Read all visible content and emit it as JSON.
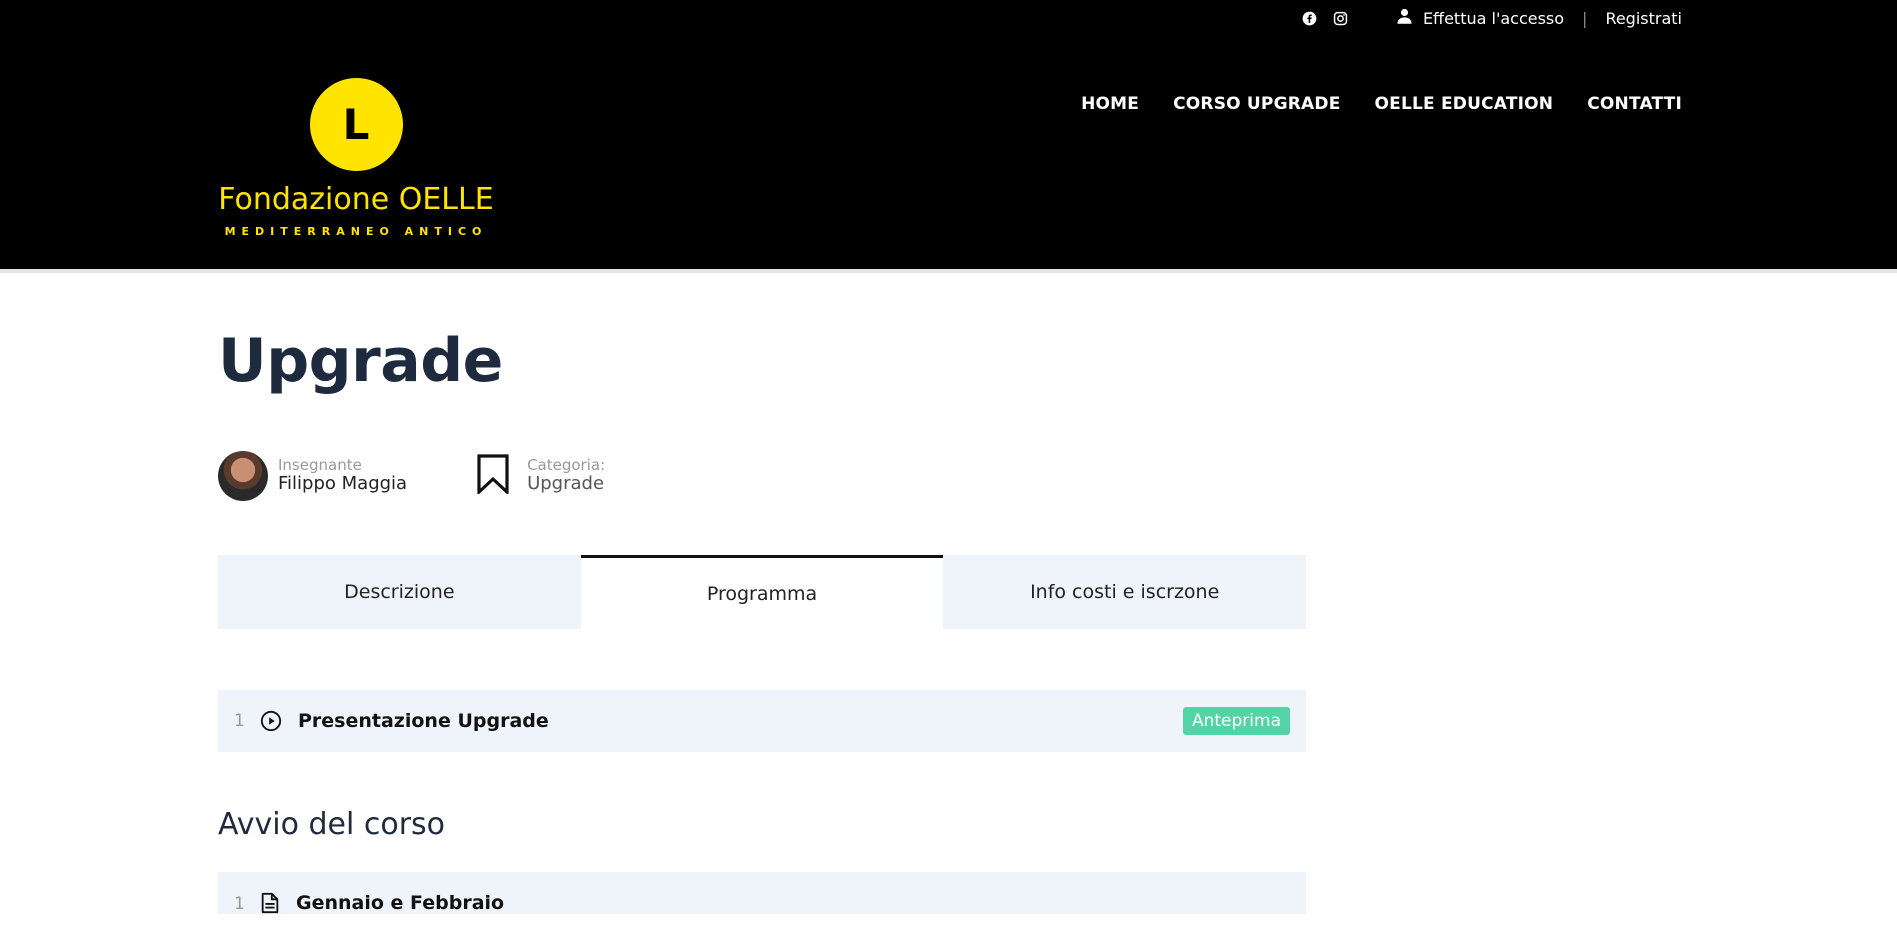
{
  "topbar": {
    "social": [
      "facebook-icon",
      "instagram-icon"
    ],
    "login": "Effettua l'accesso",
    "register": "Registrati",
    "separator": "|"
  },
  "logo": {
    "name": "Fondazione OELLE",
    "subtitle": "MEDITERRANEO ANTICO"
  },
  "nav": {
    "items": [
      "HOME",
      "CORSO UPGRADE",
      "OELLE EDUCATION",
      "CONTATTI"
    ]
  },
  "course": {
    "title": "Upgrade",
    "teacher_label": "Insegnante",
    "teacher_name": "Filippo Maggia",
    "category_label": "Categoria:",
    "category_value": "Upgrade"
  },
  "tabs": [
    {
      "label": "Descrizione",
      "active": false
    },
    {
      "label": "Programma",
      "active": true
    },
    {
      "label": "Info costi e iscrzone",
      "active": false
    }
  ],
  "curriculum": {
    "intro_lesson": {
      "number": "1",
      "title": "Presentazione Upgrade",
      "badge": "Anteprima",
      "icon": "play-circle-icon"
    },
    "section_title": "Avvio del corso",
    "section_lessons": [
      {
        "number": "1",
        "title": "Gennaio e Febbraio",
        "icon": "document-icon"
      }
    ]
  },
  "colors": {
    "header_bg": "#000000",
    "brand_yellow": "#ffe400",
    "tab_bg": "#eff3fa",
    "badge_green": "#53d4a6",
    "title_navy": "#1e2a3e"
  }
}
